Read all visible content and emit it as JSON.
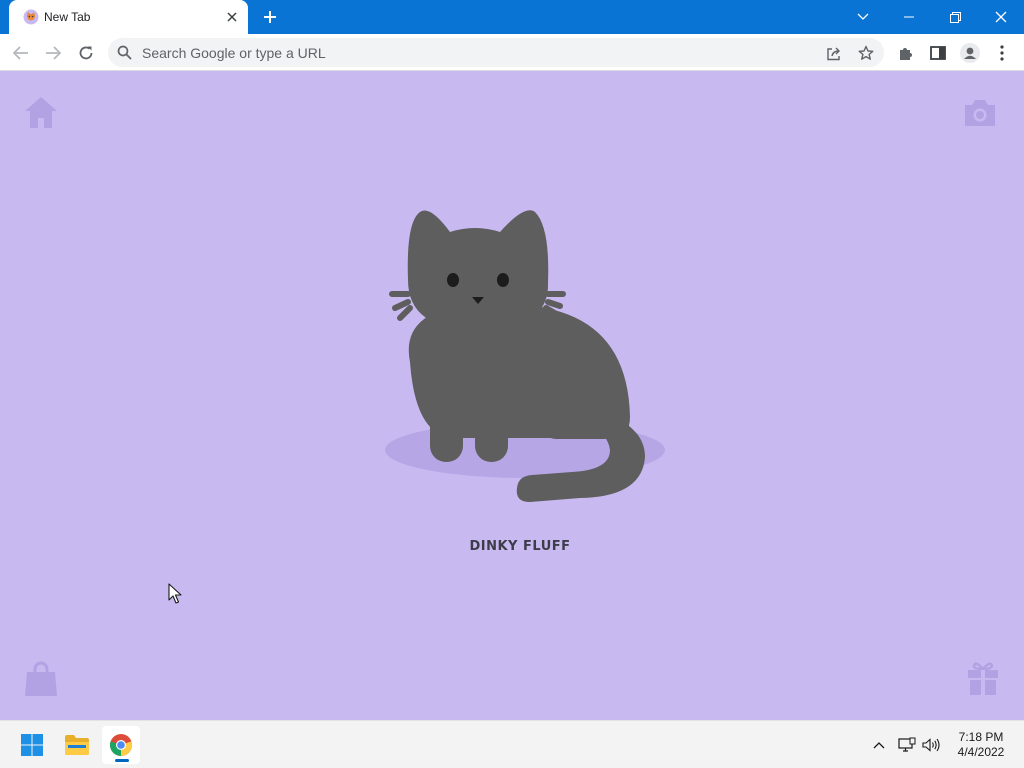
{
  "browser": {
    "tab": {
      "title": "New Tab",
      "close_icon": "close-icon",
      "favicon": "cat-favicon-icon"
    },
    "new_tab_icon": "plus-icon",
    "window_controls": [
      "chevron-down-icon",
      "minimize-icon",
      "restore-icon",
      "close-icon"
    ],
    "toolbar": {
      "back_icon": "arrow-left-icon",
      "forward_icon": "arrow-right-icon",
      "reload_icon": "reload-icon",
      "omnibox_placeholder": "Search Google or type a URL",
      "share_icon": "share-icon",
      "bookmark_icon": "star-icon",
      "extensions_icon": "puzzle-icon",
      "sidepanel_icon": "side-panel-icon",
      "profile_icon": "avatar-icon",
      "menu_icon": "kebab-menu-icon"
    }
  },
  "page": {
    "background": "#c9b9f1",
    "corner_icons": [
      "home-icon",
      "camera-icon",
      "shopping-bag-icon",
      "gift-icon"
    ],
    "pet": {
      "name": "DINKY FLUFF",
      "color": "#5e5e5e"
    }
  },
  "taskbar": {
    "apps": [
      "windows-start-icon",
      "file-explorer-icon",
      "chrome-icon"
    ],
    "tray": [
      "chevron-up-icon",
      "network-icon",
      "volume-icon"
    ],
    "time": "7:18 PM",
    "date": "4/4/2022"
  },
  "colors": {
    "titlebar": "#0a74d4",
    "accent": "#0067c0",
    "icon_tint": "#b3a2e3"
  }
}
